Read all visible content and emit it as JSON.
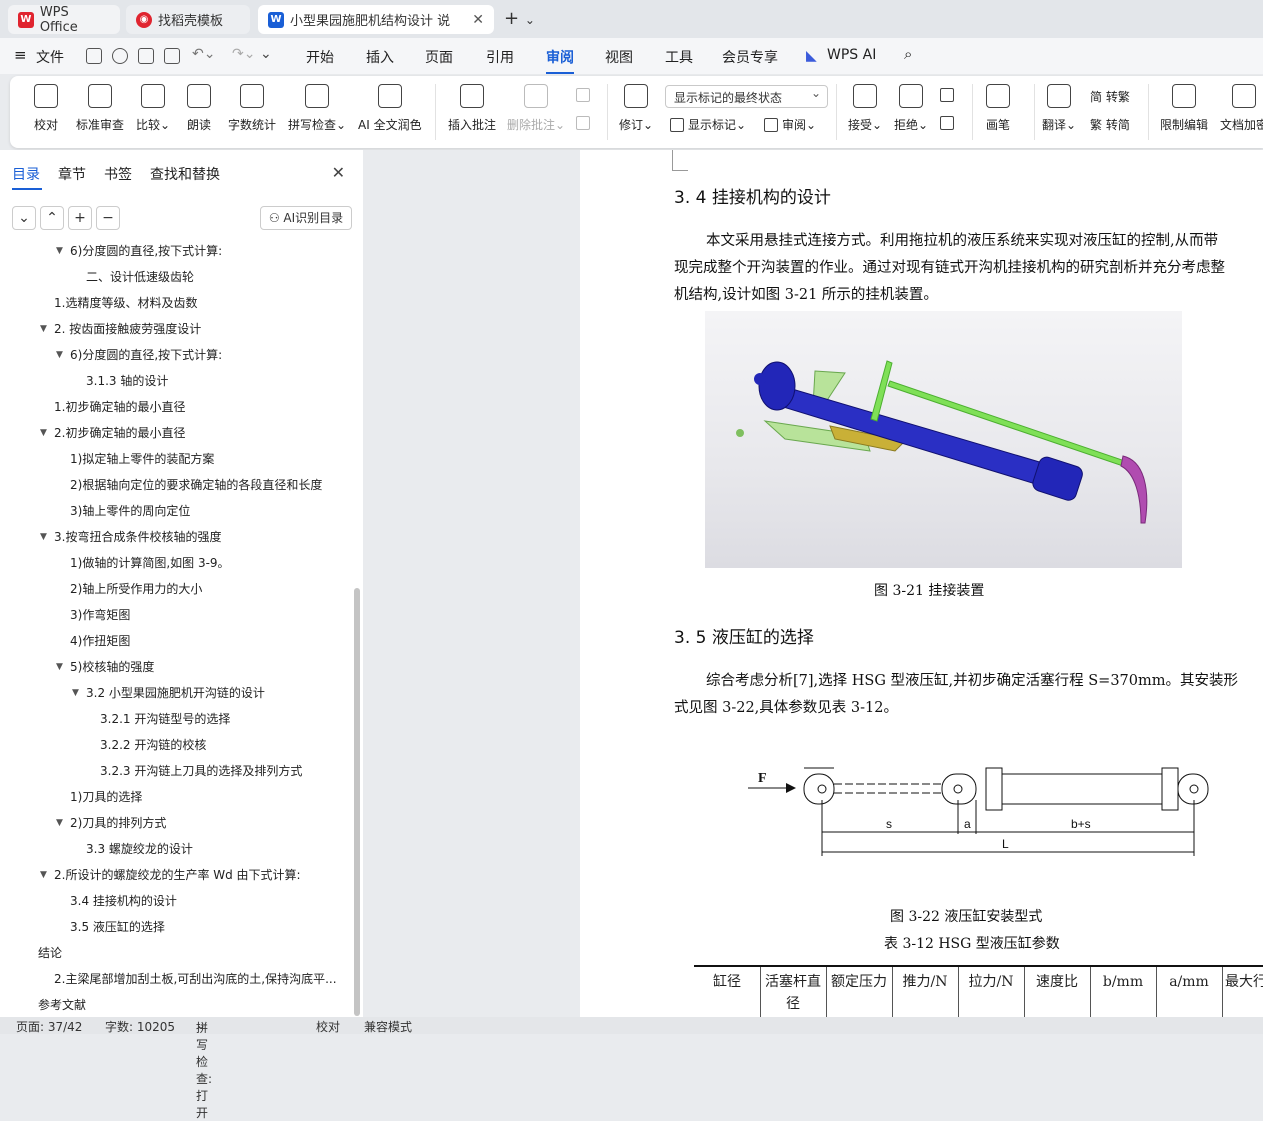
{
  "tabs": {
    "t1": "WPS Office",
    "t2": "找稻壳模板",
    "t3": "小型果园施肥机结构设计 说明"
  },
  "menu": {
    "file": "文件",
    "items": [
      "开始",
      "插入",
      "页面",
      "引用",
      "审阅",
      "视图",
      "工具",
      "会员专享",
      "WPS AI"
    ],
    "active": "审阅"
  },
  "ribbon": {
    "proof": "校对",
    "std": "标准审查",
    "compare": "比较",
    "read": "朗读",
    "wordcount": "字数统计",
    "spell": "拼写检查",
    "ai_polish": "AI 全文润色",
    "insert_comment": "插入批注",
    "delete_comment": "删除批注",
    "track": "修订",
    "show_markup": "显示标记",
    "review": "审阅",
    "display_state": "显示标记的最终状态",
    "accept": "接受",
    "reject": "拒绝",
    "pen": "画笔",
    "translate": "翻译",
    "to_trad": "简 转繁",
    "to_simp": "繁 转简",
    "restrict": "限制编辑",
    "encrypt": "文档加密"
  },
  "sidebar": {
    "tabs": [
      "目录",
      "章节",
      "书签",
      "查找和替换"
    ],
    "ai_btn": "AI识别目录",
    "items": [
      {
        "t": "6)分度圆的直径,按下式计算:",
        "i": 2,
        "a": 1
      },
      {
        "t": "二、设计低速级齿轮",
        "i": 3,
        "a": 0
      },
      {
        "t": "1.选精度等级、材料及齿数",
        "i": 1,
        "a": 0
      },
      {
        "t": "2. 按齿面接触疲劳强度设计",
        "i": 1,
        "a": 1
      },
      {
        "t": "6)分度圆的直径,按下式计算:",
        "i": 2,
        "a": 1
      },
      {
        "t": "3.1.3 轴的设计",
        "i": 3,
        "a": 0
      },
      {
        "t": "1.初步确定轴的最小直径",
        "i": 1,
        "a": 0
      },
      {
        "t": "2.初步确定轴的最小直径",
        "i": 1,
        "a": 1
      },
      {
        "t": "1)拟定轴上零件的装配方案",
        "i": 2,
        "a": 0
      },
      {
        "t": "2)根据轴向定位的要求确定轴的各段直径和长度",
        "i": 2,
        "a": 0
      },
      {
        "t": "3)轴上零件的周向定位",
        "i": 2,
        "a": 0
      },
      {
        "t": "3.按弯扭合成条件校核轴的强度",
        "i": 1,
        "a": 1
      },
      {
        "t": "1)做轴的计算简图,如图 3-9。",
        "i": 2,
        "a": 0
      },
      {
        "t": "2)轴上所受作用力的大小",
        "i": 2,
        "a": 0
      },
      {
        "t": "3)作弯矩图",
        "i": 2,
        "a": 0
      },
      {
        "t": "4)作扭矩图",
        "i": 2,
        "a": 0
      },
      {
        "t": "5)校核轴的强度",
        "i": 2,
        "a": 1
      },
      {
        "t": "3.2 小型果园施肥机开沟链的设计",
        "i": 3,
        "a": 1
      },
      {
        "t": "3.2.1 开沟链型号的选择",
        "i": 4,
        "a": 0
      },
      {
        "t": "3.2.2 开沟链的校核",
        "i": 4,
        "a": 0
      },
      {
        "t": "3.2.3 开沟链上刀具的选择及排列方式",
        "i": 4,
        "a": 0
      },
      {
        "t": "1)刀具的选择",
        "i": 2,
        "a": 0
      },
      {
        "t": "2)刀具的排列方式",
        "i": 2,
        "a": 1
      },
      {
        "t": "3.3 螺旋绞龙的设计",
        "i": 3,
        "a": 0
      },
      {
        "t": "2.所设计的螺旋绞龙的生产率 Wd 由下式计算:",
        "i": 1,
        "a": 1
      },
      {
        "t": "3.4 挂接机构的设计",
        "i": 2,
        "a": 0
      },
      {
        "t": "3.5 液压缸的选择",
        "i": 2,
        "a": 0
      },
      {
        "t": "结论",
        "i": 0,
        "a": 0
      },
      {
        "t": "2.主梁尾部增加刮土板,可刮出沟底的土,保持沟底平...",
        "i": 1,
        "a": 0
      },
      {
        "t": "参考文献",
        "i": 0,
        "a": 0
      }
    ]
  },
  "doc": {
    "h34": "3. 4 挂接机构的设计",
    "p1a": "本文采用悬挂式连接方式。利用拖拉机的液压系统来实现对液压缸的控制,从而带",
    "p1b": "现完成整个开沟装置的作业。通过对现有链式开沟机挂接机构的研究剖析并充分考虑整",
    "p1c": "机结构,设计如图 3-21 所示的挂机装置。",
    "fig21": "图 3-21 挂接装置",
    "h35": "3. 5 液压缸的选择",
    "p2a": "综合考虑分析[7],选择 HSG 型液压缸,并初步确定活塞行程 S=370mm。其安装形",
    "p2b": "式见图 3-22,具体参数见表 3-12。",
    "fig22": "图 3-22 液压缸安装型式",
    "tbl": "表 3-12 HSG 型液压缸参数",
    "diagram": {
      "F": "F",
      "s": "s",
      "a": "a",
      "bs": "b+s",
      "L": "L"
    },
    "cols": [
      "缸径",
      "活塞杆直径",
      "额定压力",
      "推力/N",
      "拉力/N",
      "速度比",
      "b/mm",
      "a/mm",
      "最大行程"
    ]
  },
  "status": {
    "page": "页面: 37/42",
    "words": "字数: 10205",
    "spell": "拼写检查: 打开",
    "proof": "校对",
    "compat": "兼容模式"
  }
}
